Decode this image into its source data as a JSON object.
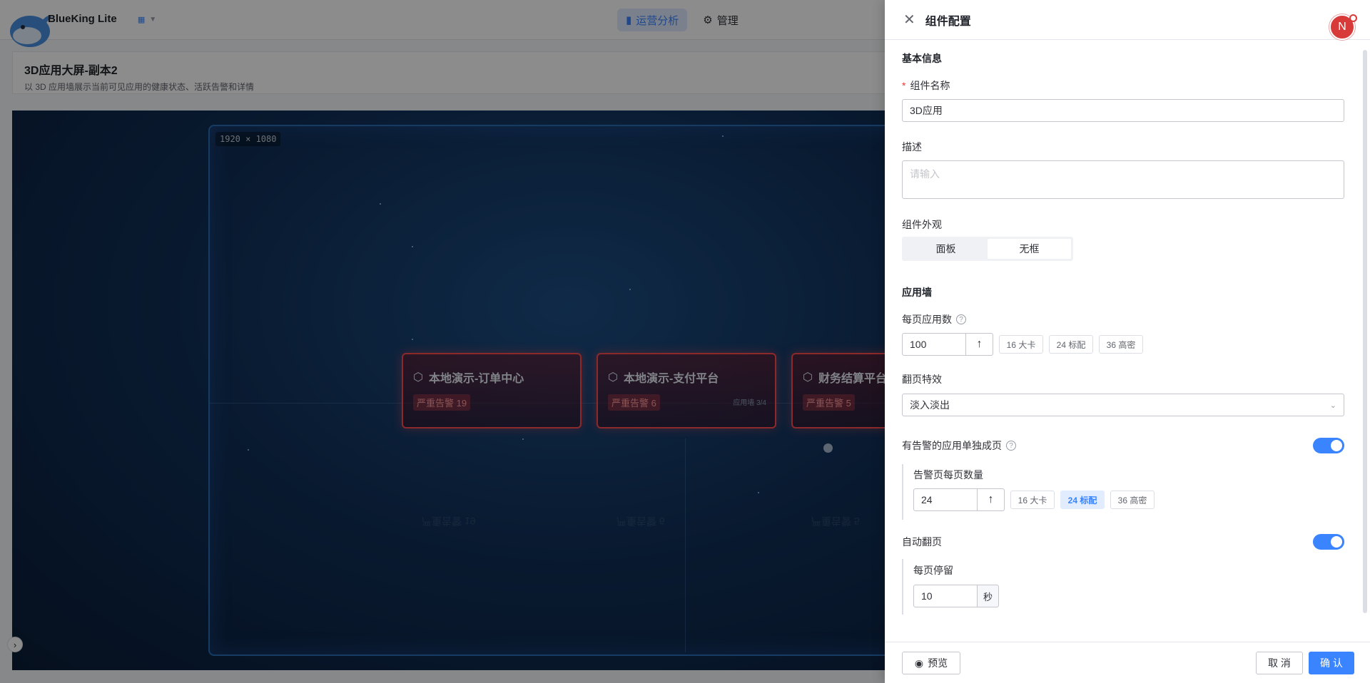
{
  "app": {
    "brand": "BlueKing Lite",
    "nav": [
      {
        "label": "运营分析",
        "icon": "chart-icon"
      },
      {
        "label": "管理",
        "icon": "settings-icon"
      }
    ]
  },
  "page": {
    "title": "3D应用大屏-副本2",
    "description": "以 3D 应用墙展示当前可见应用的健康状态、活跃告警和详情"
  },
  "canvas": {
    "size_label": "1920 × 1080",
    "cards": [
      {
        "name": "本地演示-订单中心",
        "badge": "严重告警 19"
      },
      {
        "name": "本地演示-支付平台",
        "badge": "严重告警 6",
        "page_indicator": "应用墙 3/4"
      },
      {
        "name": "财务结算平台",
        "badge": "严重告警 5"
      }
    ],
    "reflections": [
      "严重告警 19",
      "严重告警 6",
      "严重告警 5"
    ]
  },
  "drawer": {
    "title": "组件配置",
    "avatar": "N",
    "basic_section": "基本信息",
    "name_label": "组件名称",
    "name_value": "3D应用",
    "desc_label": "描述",
    "desc_placeholder": "请输入",
    "appearance_label": "组件外观",
    "appearance_options": [
      "面板",
      "无框"
    ],
    "appearance_selected": "无框",
    "wall_section": "应用墙",
    "per_page_label": "每页应用数",
    "per_page_value": "100",
    "per_page_presets": [
      "16 大卡",
      "24 标配",
      "36 高密"
    ],
    "transition_label": "翻页特效",
    "transition_value": "淡入淡出",
    "alert_page_label": "有告警的应用单独成页",
    "alert_page_enabled": true,
    "alert_per_page_label": "告警页每页数量",
    "alert_per_page_value": "24",
    "alert_per_page_presets": [
      "16 大卡",
      "24 标配",
      "36 高密"
    ],
    "alert_per_page_selected": "24 标配",
    "auto_flip_label": "自动翻页",
    "auto_flip_enabled": true,
    "dwell_label": "每页停留",
    "dwell_value": "10",
    "dwell_unit": "秒",
    "preview_label": "预览",
    "cancel_label": "取 消",
    "confirm_label": "确 认"
  },
  "colors": {
    "primary": "#3a84ff",
    "alert": "#ff4d4f",
    "canvas_bg": "#0a1d38"
  }
}
